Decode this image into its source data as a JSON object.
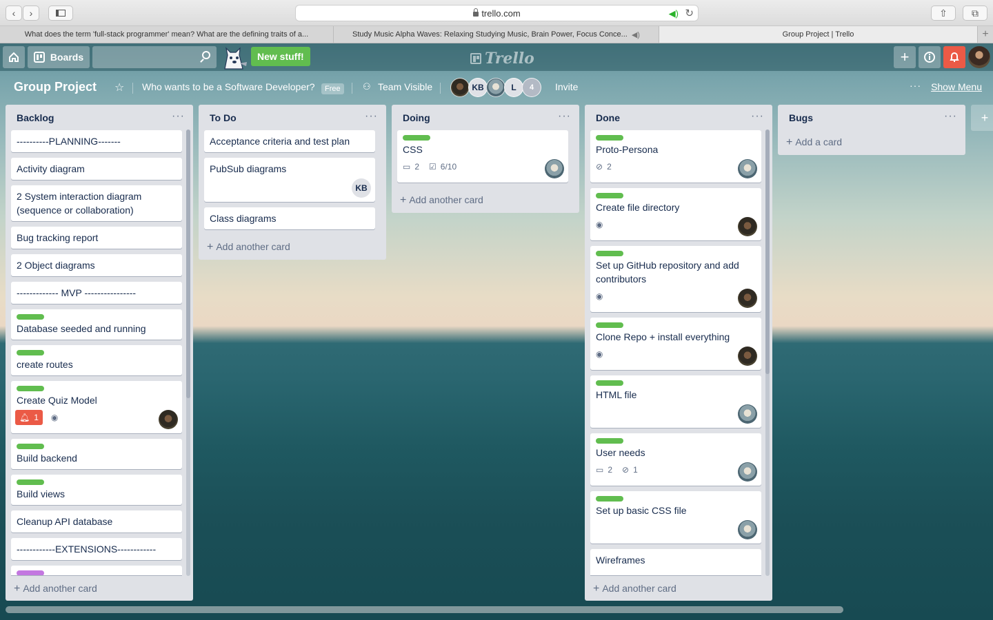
{
  "browser": {
    "url": "trello.com",
    "tabs": [
      {
        "title": "What does the term 'full-stack programmer' mean? What are the defining traits of a...",
        "active": false
      },
      {
        "title": "Study Music Alpha Waves: Relaxing Studying Music, Brain Power, Focus Conce...",
        "active": false,
        "muted": true
      },
      {
        "title": "Group Project | Trello",
        "active": true
      }
    ]
  },
  "header": {
    "boards_label": "Boards",
    "new_stuff_label": "New stuff!",
    "logo_text": "Trello"
  },
  "board": {
    "title": "Group Project",
    "team_name": "Who wants to be a Software Developer?",
    "plan_badge": "Free",
    "visibility": "Team Visible",
    "members": [
      {
        "initials": "",
        "kind": "photo"
      },
      {
        "initials": "KB",
        "kind": "initials"
      },
      {
        "initials": "",
        "kind": "photo"
      },
      {
        "initials": "L",
        "kind": "initials"
      },
      {
        "initials": "4",
        "kind": "count"
      }
    ],
    "invite_label": "Invite",
    "show_menu_label": "Show Menu"
  },
  "lists": [
    {
      "title": "Backlog",
      "add_card_label": "Add another card",
      "cards": [
        {
          "title": "----------PLANNING-------"
        },
        {
          "title": "Activity diagram"
        },
        {
          "title": "2 System interaction diagram (sequence or collaboration)"
        },
        {
          "title": "Bug tracking report"
        },
        {
          "title": "2 Object diagrams"
        },
        {
          "title": "------------- MVP ----------------"
        },
        {
          "title": "Database seeded and running",
          "label": "green"
        },
        {
          "title": "create routes",
          "label": "green"
        },
        {
          "title": "Create Quiz Model",
          "label": "green",
          "notifications": "1"
        },
        {
          "title": "Build backend",
          "label": "green"
        },
        {
          "title": "Build views",
          "label": "green"
        },
        {
          "title": "Cleanup API database"
        },
        {
          "title": "------------EXTENSIONS------------"
        },
        {
          "title": "",
          "label": "purple"
        }
      ]
    },
    {
      "title": "To Do",
      "add_card_label": "Add another card",
      "cards": [
        {
          "title": "Acceptance criteria and test plan"
        },
        {
          "title": "PubSub diagrams",
          "member": "KB"
        },
        {
          "title": "Class diagrams"
        }
      ]
    },
    {
      "title": "Doing",
      "add_card_label": "Add another card",
      "cards": [
        {
          "title": "CSS",
          "label": "green",
          "comments": "2",
          "checklist": "6/10"
        }
      ]
    },
    {
      "title": "Done",
      "add_card_label": "Add another card",
      "cards": [
        {
          "title": "Proto-Persona",
          "label": "green",
          "attachments": "2"
        },
        {
          "title": "Create file directory",
          "label": "green"
        },
        {
          "title": "Set up GitHub repository and add contributors",
          "label": "green"
        },
        {
          "title": "Clone Repo + install everything",
          "label": "green"
        },
        {
          "title": "HTML file",
          "label": "green"
        },
        {
          "title": "User needs",
          "label": "green",
          "comments": "2",
          "attachments": "1"
        },
        {
          "title": "Set up basic CSS file",
          "label": "green"
        },
        {
          "title": "Wireframes"
        }
      ]
    },
    {
      "title": "Bugs",
      "add_card_label": "Add a card",
      "cards": []
    }
  ],
  "colors": {
    "label_green": "#61bd4f",
    "label_purple": "#c377e0",
    "notification_red": "#eb5a46",
    "list_bg": "#dfe1e6"
  }
}
